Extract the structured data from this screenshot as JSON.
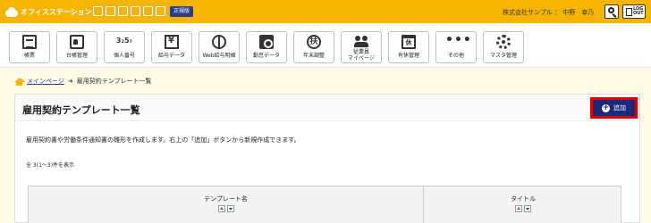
{
  "app": {
    "name": "オフィスステーション",
    "edition": "正規版",
    "user_text": "株式会社サンプル ： 中野　幸乃",
    "logout_label": "LOG OUT"
  },
  "nav": {
    "items": [
      {
        "label": "帳票",
        "icon": "document-icon"
      },
      {
        "label": "台帳管理",
        "icon": "ledger-card-icon"
      },
      {
        "label": "個人番号",
        "icon": "personal-number-icon",
        "glyph": "3₂5₇"
      },
      {
        "label": "給与データ",
        "icon": "payroll-data-icon"
      },
      {
        "label": "Web給与明細",
        "icon": "web-payslip-icon"
      },
      {
        "label": "勤怠データ",
        "icon": "attendance-clock-icon"
      },
      {
        "label": "年末調整",
        "icon": "year-end-adjustment-icon",
        "glyph": "扶"
      },
      {
        "label_line1": "従業員",
        "label_line2": "マイページ",
        "icon": "employee-mypage-icon"
      },
      {
        "label": "有休管理",
        "icon": "paid-leave-calendar-icon",
        "glyph": "休"
      },
      {
        "label": "その他",
        "icon": "more-dots-icon",
        "glyph": "•••"
      },
      {
        "label": "マスタ管理",
        "icon": "master-settings-gear-icon"
      }
    ]
  },
  "breadcrumb": {
    "home": "メインページ",
    "arrow": "➔",
    "current": "雇用契約テンプレート一覧"
  },
  "page": {
    "title": "雇用契約テンプレート一覧",
    "add_label": "追加",
    "description": "雇用契約書や労働条件通知書の雛形を作成します。右上の「追加」ボタンから新規作成できます。",
    "count_text": "全 3(1〜3)件を表示"
  },
  "table": {
    "columns": [
      "テンプレート名",
      "タイトル"
    ]
  },
  "colors": {
    "brand": "#f5b400",
    "button": "#1a2a7a",
    "highlight": "#e00000",
    "link": "#1a43a6"
  }
}
